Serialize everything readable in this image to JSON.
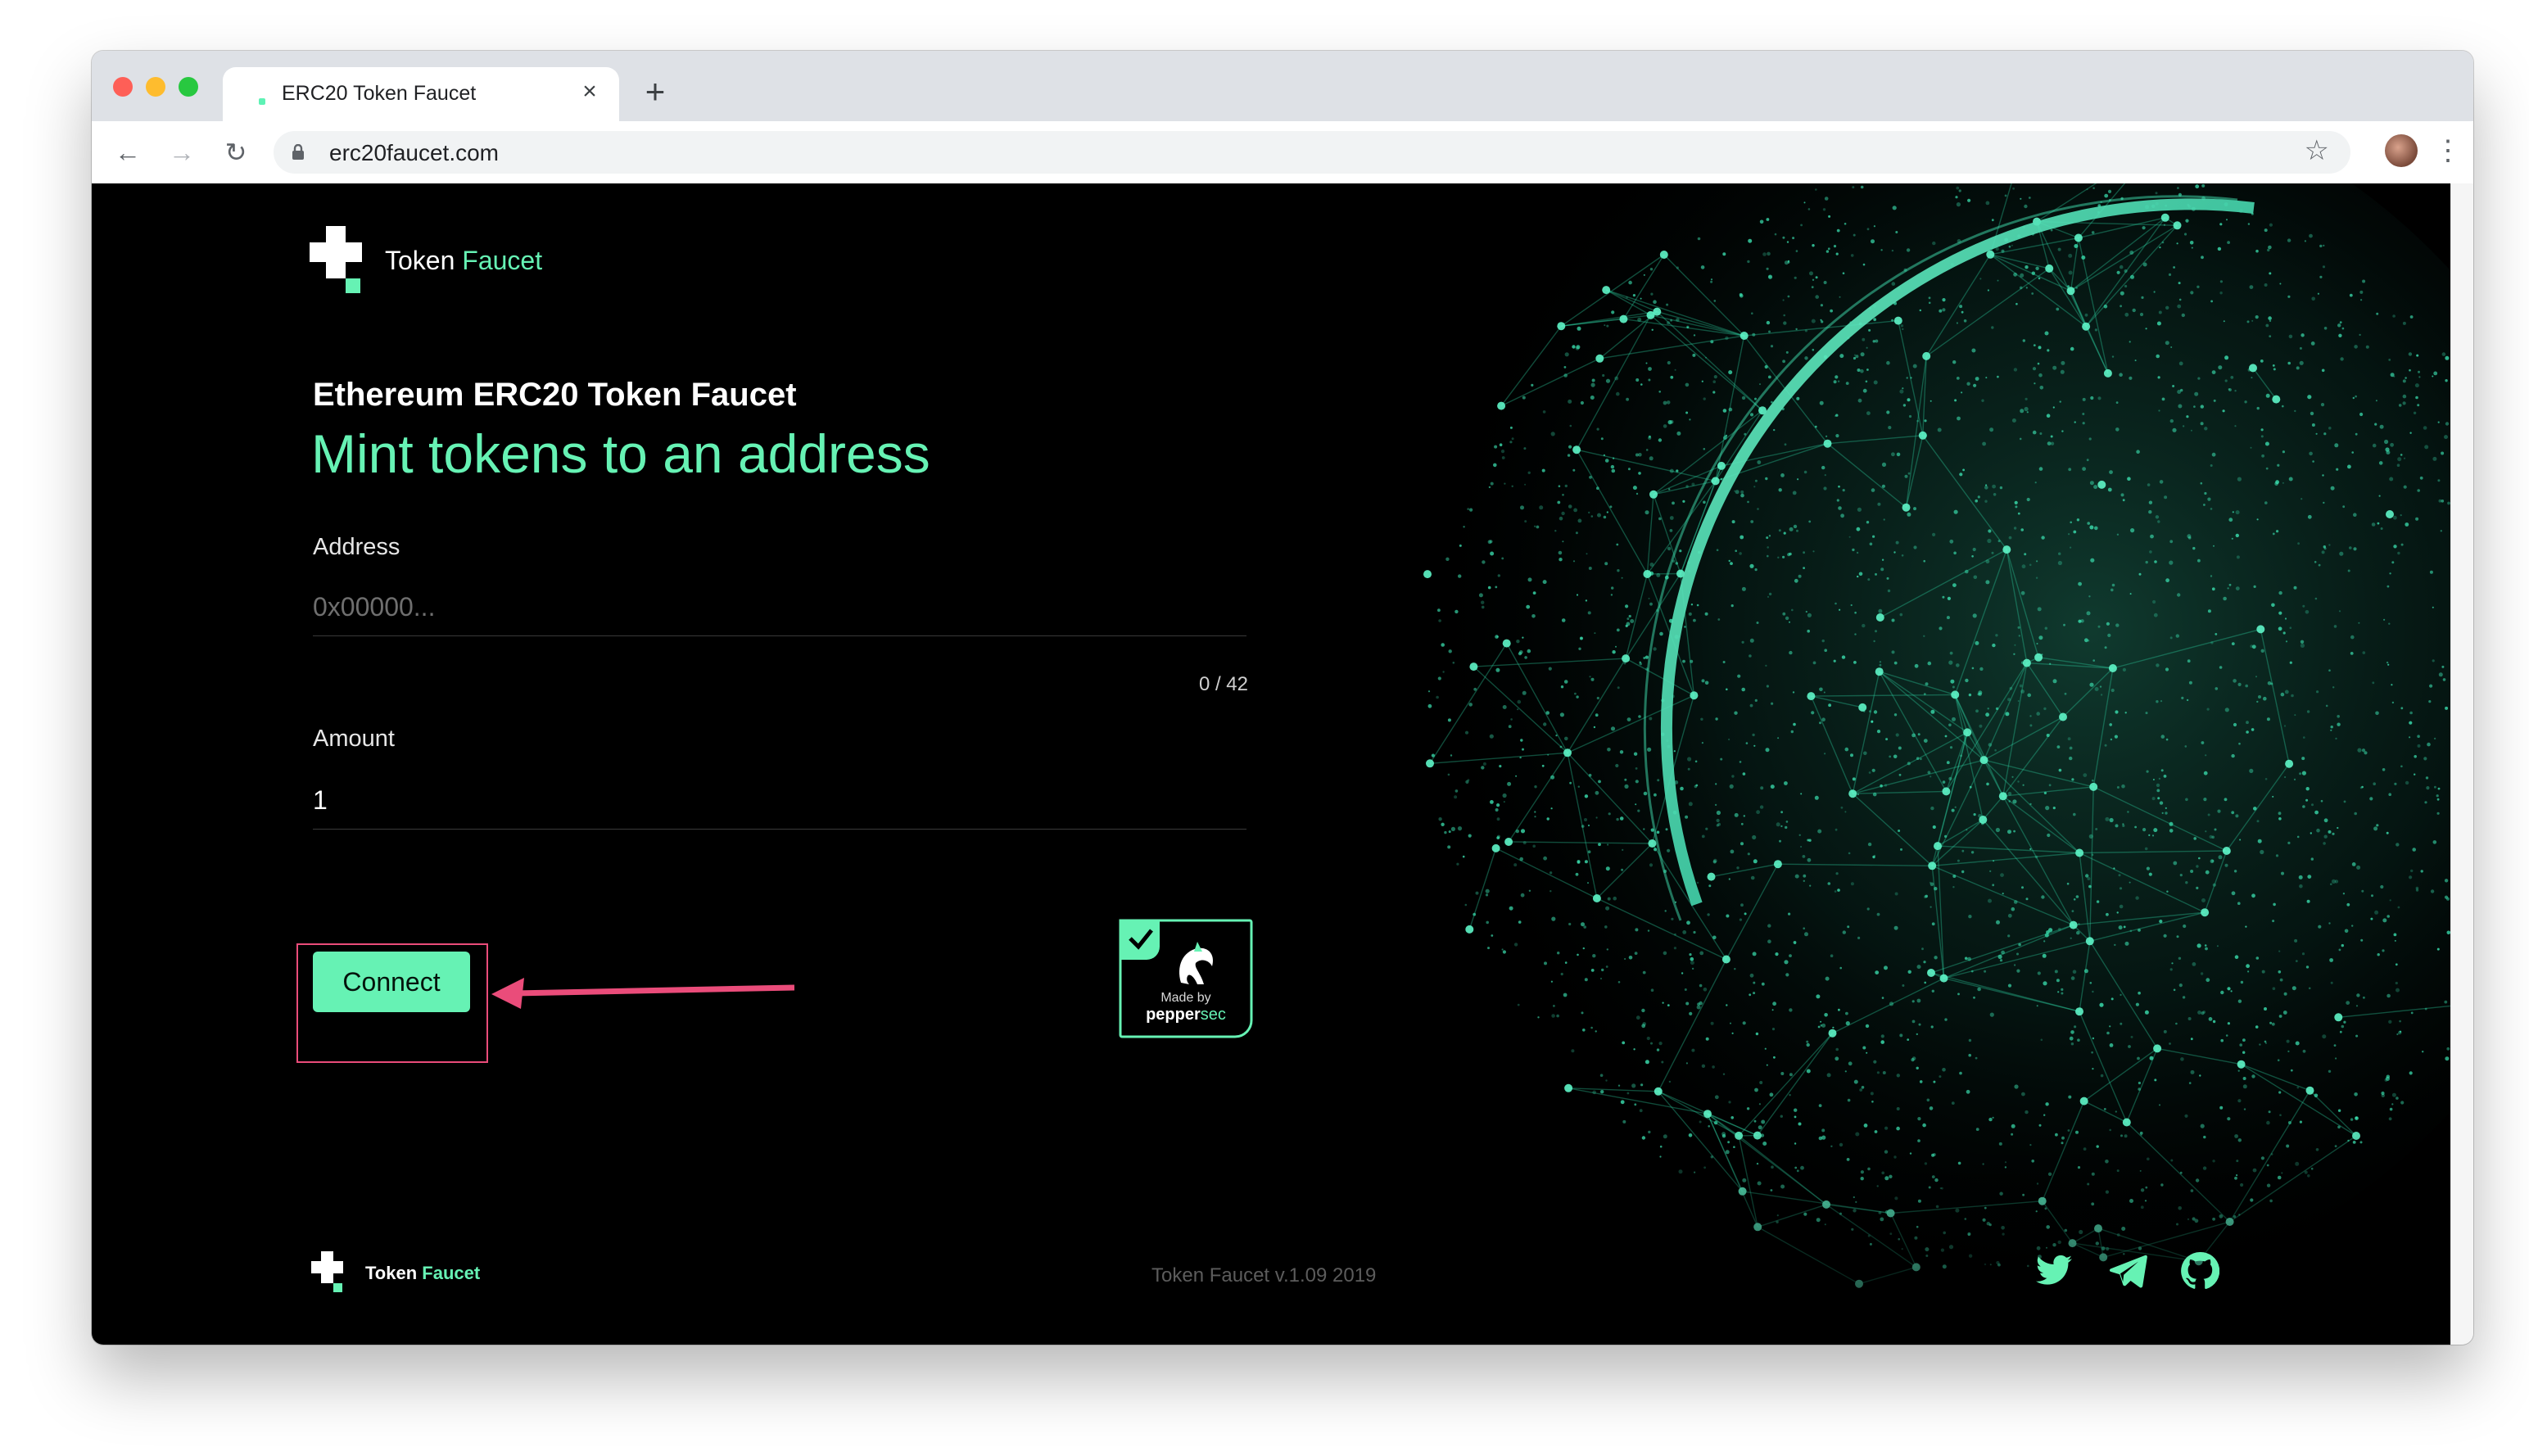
{
  "browser": {
    "tab_title": "ERC20 Token Faucet",
    "tab_close_icon": "close-icon",
    "new_tab_label": "+",
    "url": "erc20faucet.com"
  },
  "brand": {
    "name": "Token",
    "name_accent": "Faucet",
    "accent_color": "#66f2b4"
  },
  "header": {
    "subtitle": "Ethereum ERC20 Token Faucet",
    "title": "Mint tokens to an address"
  },
  "form": {
    "address_label": "Address",
    "address_placeholder": "0x00000...",
    "address_value": "",
    "address_counter": "0 / 42",
    "amount_label": "Amount",
    "amount_value": "1",
    "connect_label": "Connect"
  },
  "badge": {
    "made_by": "Made by",
    "brand": "pepper",
    "brand_accent": "sec"
  },
  "footer": {
    "version": "Token Faucet v.1.09 2019",
    "social_icons": [
      "twitter-icon",
      "telegram-icon",
      "github-icon"
    ]
  },
  "annotation": {
    "highlight_color": "#ea4c7a"
  }
}
